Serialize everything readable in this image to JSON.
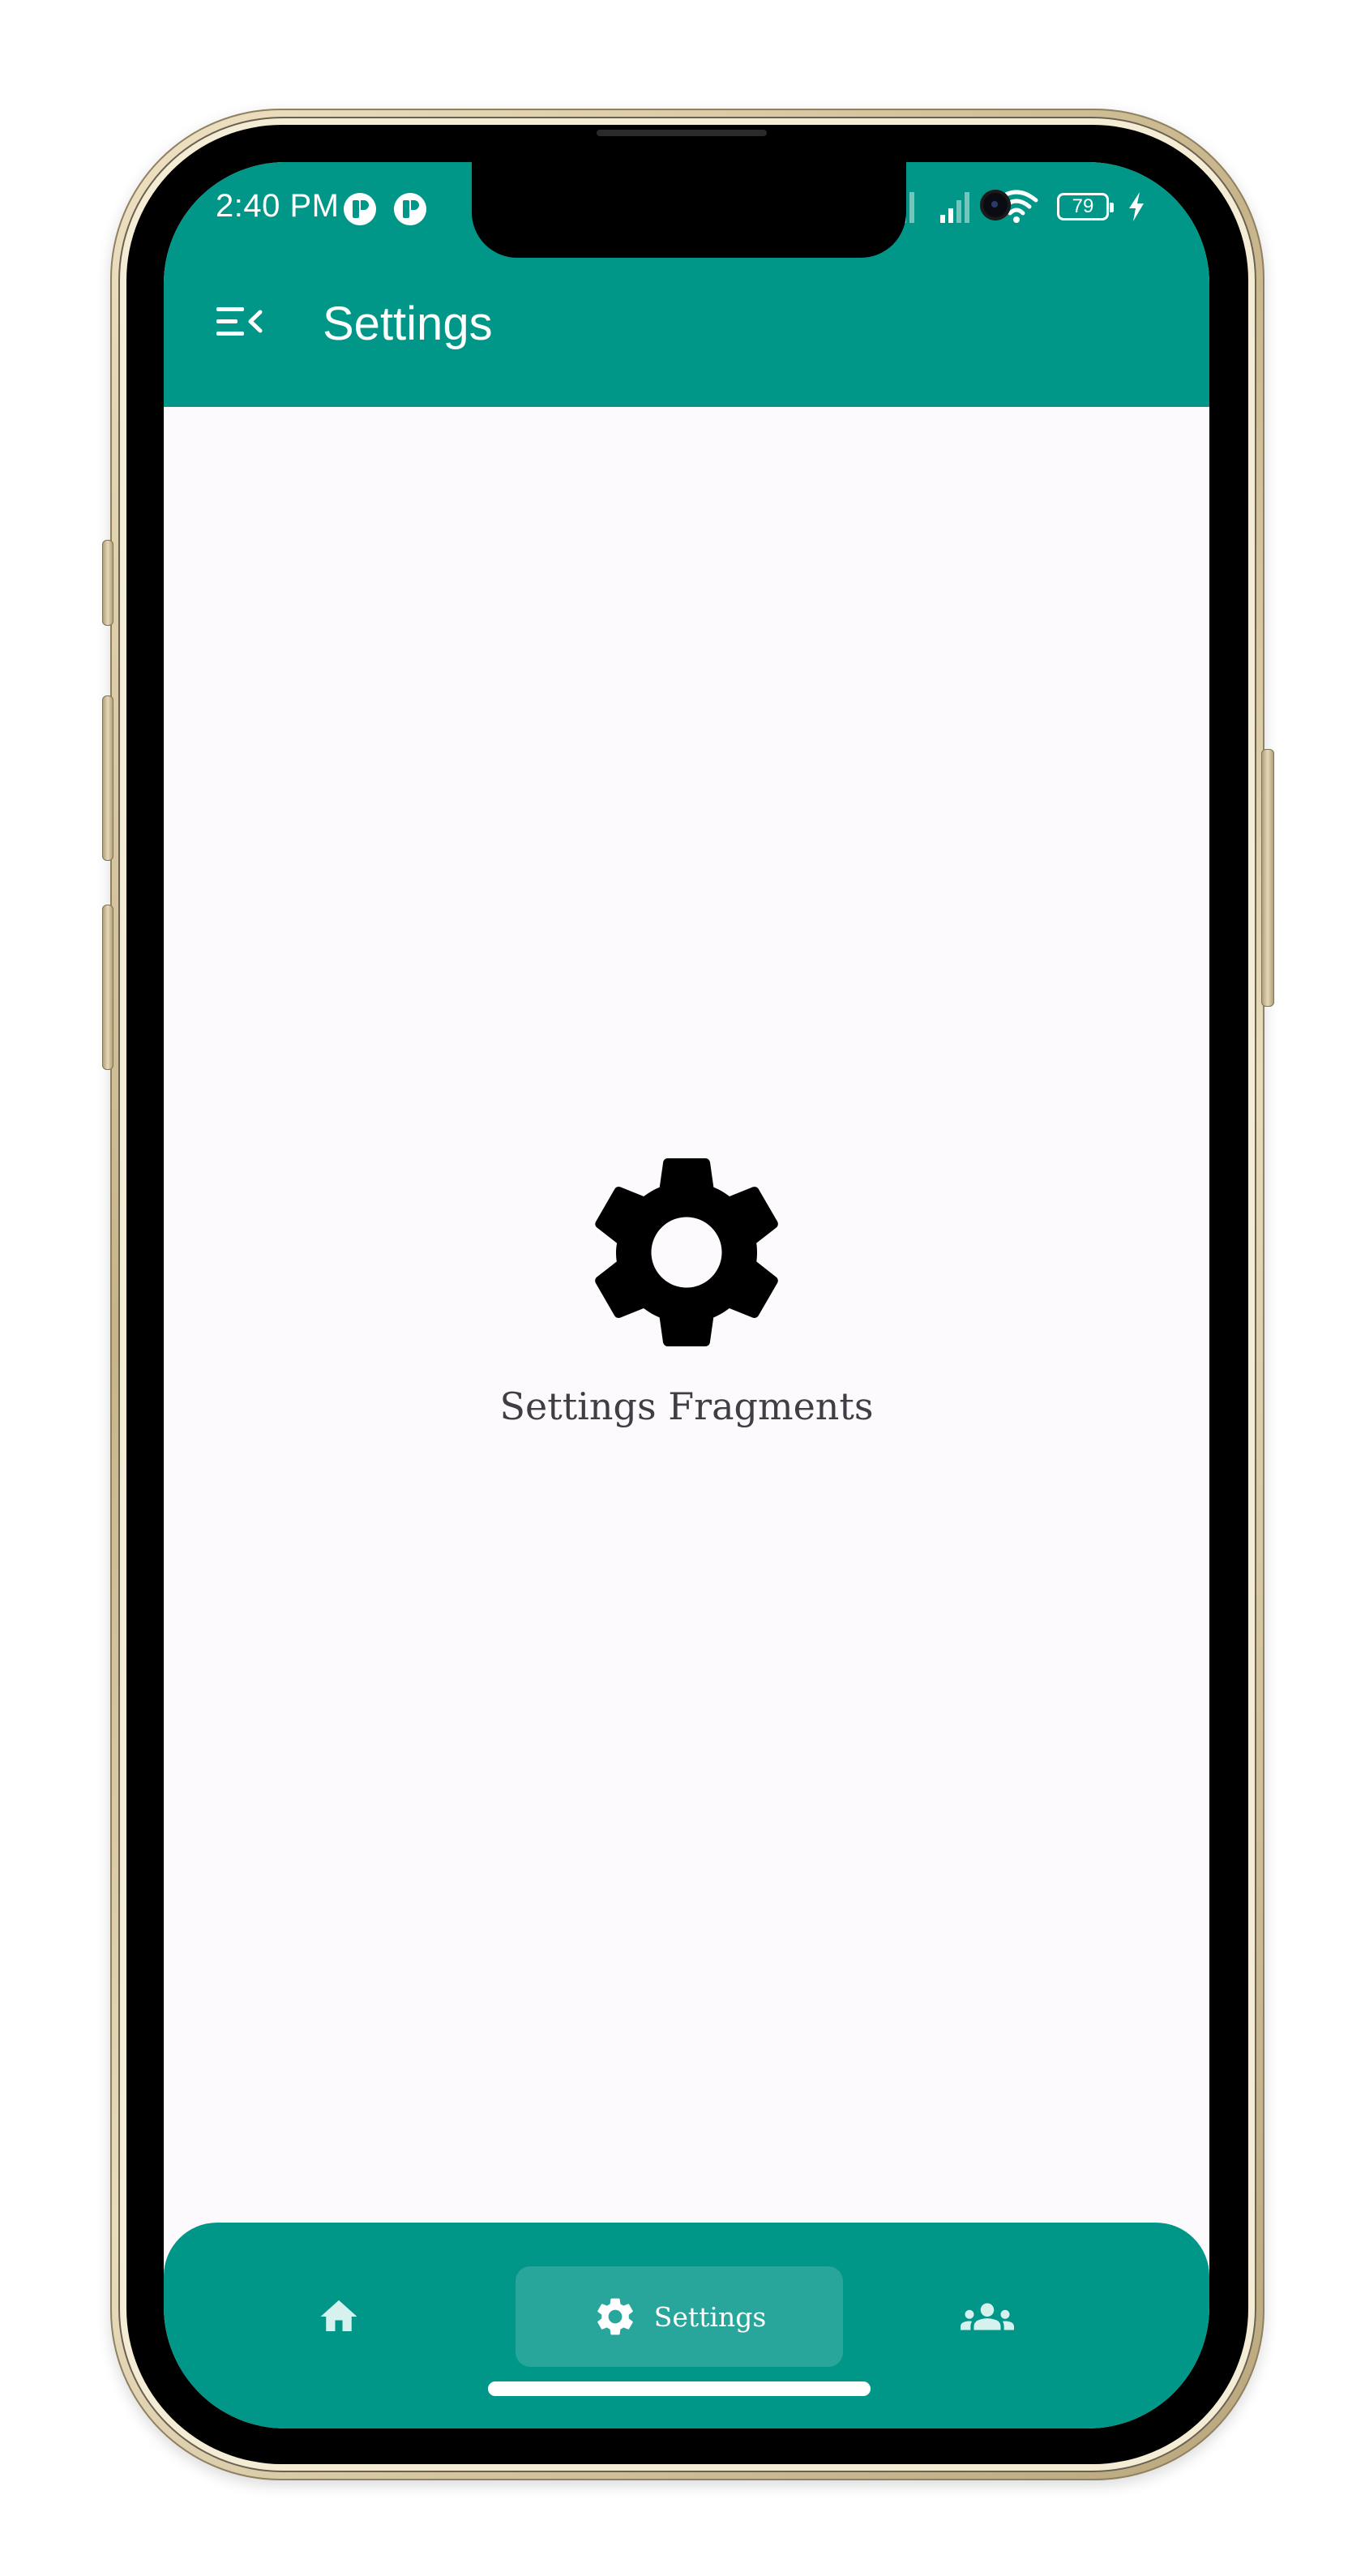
{
  "status_bar": {
    "time": "2:40 PM",
    "battery": "79"
  },
  "app_bar": {
    "menu_icon": "menu-open-icon",
    "title": "Settings",
    "color": "#009688"
  },
  "content": {
    "icon": "gear-icon",
    "text": "Settings Fragments",
    "background": "#fdfafd"
  },
  "bottom_nav": {
    "items": [
      {
        "icon": "home-icon",
        "label": ""
      },
      {
        "icon": "gear-icon",
        "label": "Settings",
        "selected": true
      },
      {
        "icon": "group-icon",
        "label": ""
      }
    ],
    "color": "#009688"
  }
}
